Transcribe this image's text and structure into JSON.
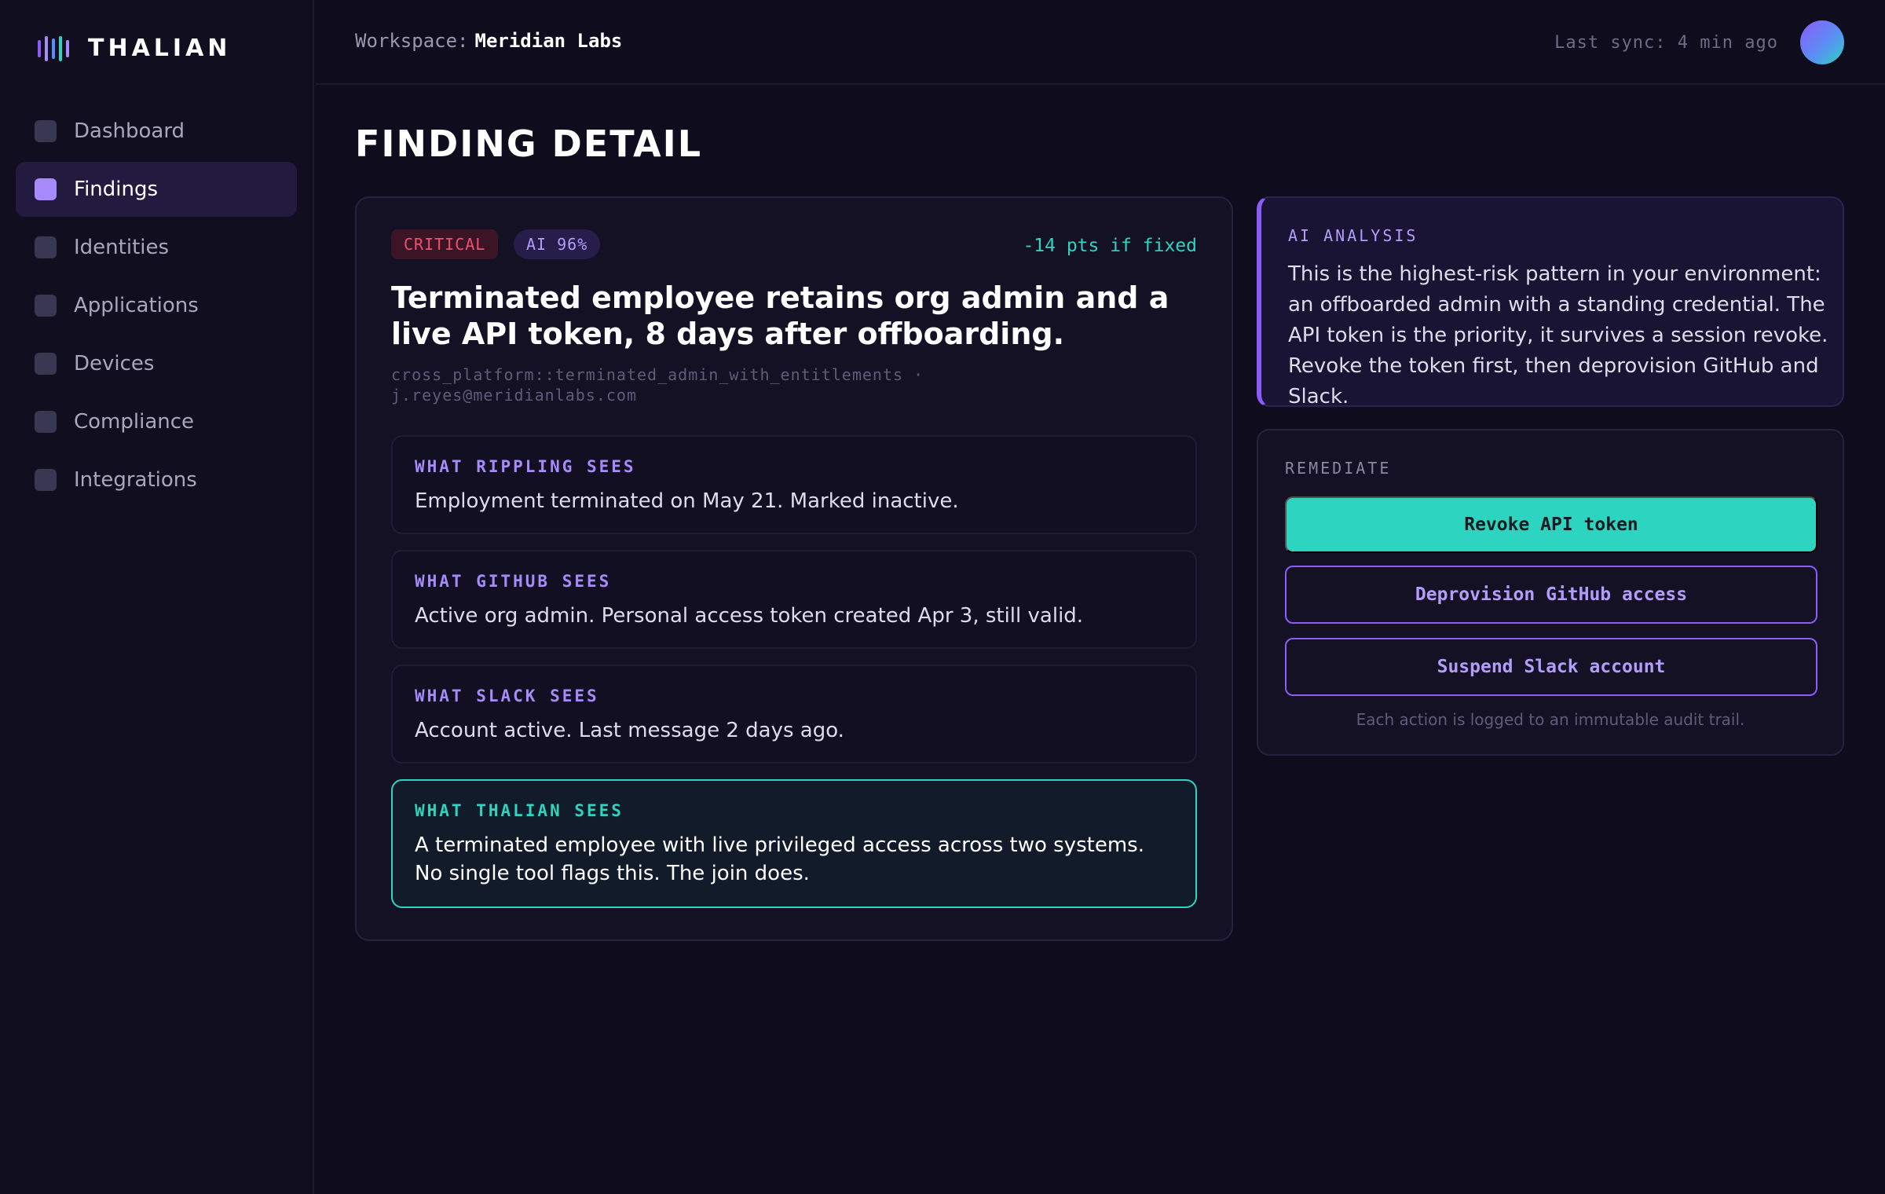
{
  "brand": {
    "name": "THALIAN",
    "logo_colors": [
      "#8b5cf6",
      "#a78bfa",
      "#5b8df6",
      "#2dd4bf",
      "#a78bfa"
    ]
  },
  "sidebar": {
    "items": [
      {
        "label": "Dashboard",
        "active": false
      },
      {
        "label": "Findings",
        "active": true
      },
      {
        "label": "Identities",
        "active": false
      },
      {
        "label": "Applications",
        "active": false
      },
      {
        "label": "Devices",
        "active": false
      },
      {
        "label": "Compliance",
        "active": false
      },
      {
        "label": "Integrations",
        "active": false
      }
    ]
  },
  "topbar": {
    "workspace_label": "Workspace:",
    "workspace_name": "Meridian Labs",
    "last_sync": "Last sync: 4 min ago"
  },
  "page": {
    "title": "FINDING DETAIL"
  },
  "finding": {
    "severity": "CRITICAL",
    "ai_confidence": "AI 96%",
    "score_impact": "-14 pts if fixed",
    "title": "Terminated employee retains org admin and a live API token, 8 days after offboarding.",
    "rule_id": "cross_platform::terminated_admin_with_entitlements",
    "separator": "·",
    "subject": "j.reyes@meridianlabs.com",
    "perspectives": [
      {
        "label": "WHAT RIPPLING SEES",
        "text": "Employment terminated on May 21. Marked inactive."
      },
      {
        "label": "WHAT GITHUB SEES",
        "text": "Active org admin. Personal access token created Apr 3, still valid."
      },
      {
        "label": "WHAT SLACK SEES",
        "text": "Account active. Last message 2 days ago."
      },
      {
        "label": "WHAT THALIAN SEES",
        "text": "A terminated employee with live privileged access across two systems. No single tool flags this. The join does."
      }
    ]
  },
  "ai_analysis": {
    "label": "AI ANALYSIS",
    "text": "This is the highest-risk pattern in your environment: an offboarded admin with a standing credential. The API token is the priority, it survives a session revoke. Revoke the token first, then deprovision GitHub and Slack."
  },
  "remediate": {
    "label": "REMEDIATE",
    "primary_action": "Revoke API token",
    "secondary_action": "Deprovision GitHub access",
    "tertiary_action": "Suspend Slack account",
    "audit_note": "Each action is logged to an immutable audit trail."
  },
  "colors": {
    "accent_purple": "#8b5cf6",
    "accent_teal": "#2dd4bf",
    "critical_red": "#f0506e",
    "background": "#0f0d1d"
  }
}
